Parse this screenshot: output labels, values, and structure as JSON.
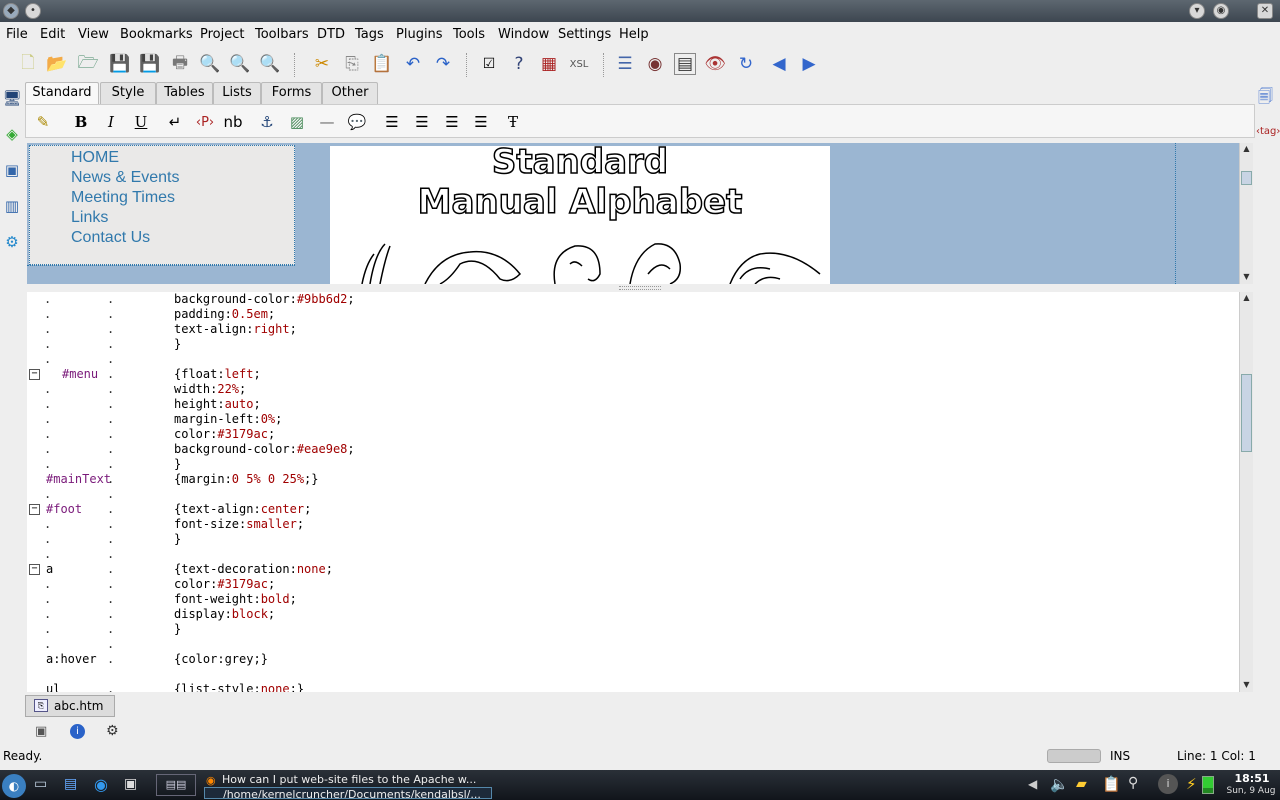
{
  "menubar": [
    "File",
    "Edit",
    "View",
    "Bookmarks",
    "Project",
    "Toolbars",
    "DTD",
    "Tags",
    "Plugins",
    "Tools",
    "Window",
    "Settings",
    "Help"
  ],
  "tabs": [
    "Standard",
    "Style",
    "Tables",
    "Lists",
    "Forms",
    "Other"
  ],
  "format_toolbar": {
    "bold": "B",
    "italic": "I",
    "underline": "U",
    "nbsp": "nb"
  },
  "preview": {
    "menu": [
      "HOME",
      "News & Events",
      "Meeting Times",
      "Links",
      "Contact Us"
    ],
    "image_title_1": "Standard",
    "image_title_2": "Manual Alphabet"
  },
  "code": [
    {
      "p": "background-color:",
      "v": "#9bb6d2",
      "e": ";"
    },
    {
      "p": "padding:",
      "v": "0.5em",
      "e": ";"
    },
    {
      "p": "text-align:",
      "v": "right",
      "e": ";"
    },
    {
      "p": "}",
      "v": "",
      "e": ""
    },
    {
      "sel": "#menu",
      "p": "{float:",
      "v": "left",
      "e": ";"
    },
    {
      "p": "width:",
      "v": "22%",
      "e": ";"
    },
    {
      "p": "height:",
      "v": "auto",
      "e": ";"
    },
    {
      "p": "margin-left:",
      "v": "0%",
      "e": ";"
    },
    {
      "p": "color:",
      "v": "#3179ac",
      "e": ";"
    },
    {
      "p": "background-color:",
      "v": "#eae9e8",
      "e": ";"
    },
    {
      "p": "}",
      "v": "",
      "e": ""
    },
    {
      "sel": "#mainText",
      "p": "{margin:",
      "v": "0 5% 0 25%",
      "e": ";}"
    },
    {
      "sel": "#foot",
      "p": "{text-align:",
      "v": "center",
      "e": ";"
    },
    {
      "p": "font-size:",
      "v": "smaller",
      "e": ";"
    },
    {
      "p": "}",
      "v": "",
      "e": ""
    },
    {
      "sel": "a",
      "p": "{text-decoration:",
      "v": "none",
      "e": ";"
    },
    {
      "p": "color:",
      "v": "#3179ac",
      "e": ";"
    },
    {
      "p": "font-weight:",
      "v": "bold",
      "e": ";"
    },
    {
      "p": "display:",
      "v": "block",
      "e": ";"
    },
    {
      "p": "}",
      "v": "",
      "e": ""
    },
    {
      "sel": "a:hover",
      "p": "{color:grey;}",
      "v": "",
      "e": ""
    },
    {
      "sel": "ul",
      "p": "{list-style:",
      "v": "none",
      "e": ";}"
    }
  ],
  "file_tab": "abc.htm",
  "status": {
    "left": "Ready.",
    "mode": "INS",
    "position": "Line: 1 Col: 1"
  },
  "taskbar": {
    "window1": "How can I put web-site files to the Apache w...",
    "window2": "/home/kernelcruncher/Documents/kendalbsl/...",
    "time": "18:51",
    "date": "Sun, 9 Aug"
  },
  "colors": {
    "preview_bg": "#9bb6d2",
    "menu_link": "#3179ac",
    "menu_bg": "#eae9e8"
  }
}
